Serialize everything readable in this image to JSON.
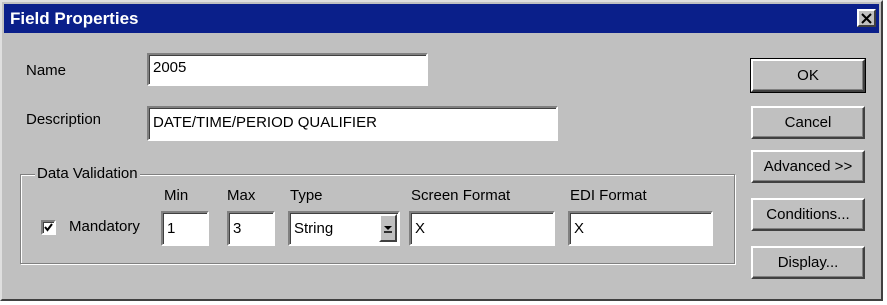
{
  "window": {
    "title": "Field Properties",
    "icons": {
      "close": "close-icon"
    }
  },
  "form": {
    "name_label": "Name",
    "name_value": "2005",
    "description_label": "Description",
    "description_value": "DATE/TIME/PERIOD QUALIFIER"
  },
  "data_validation": {
    "group_title": "Data Validation",
    "mandatory_label": "Mandatory",
    "mandatory_checked": true,
    "min_label": "Min",
    "min_value": "1",
    "max_label": "Max",
    "max_value": "3",
    "type_label": "Type",
    "type_value": "String",
    "screen_format_label": "Screen Format",
    "screen_format_value": "X",
    "edi_format_label": "EDI Format",
    "edi_format_value": "X"
  },
  "buttons": {
    "ok": "OK",
    "cancel": "Cancel",
    "advanced": "Advanced >>",
    "conditions": "Conditions...",
    "display": "Display..."
  },
  "colors": {
    "titlebar": "#0a1f8a",
    "face": "#c0c0c0"
  }
}
